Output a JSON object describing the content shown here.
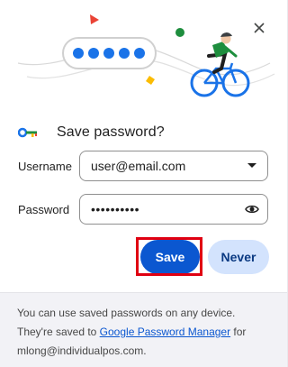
{
  "dialog": {
    "title": "Save password?",
    "close_icon": "close-icon",
    "key_icon": "key-icon"
  },
  "fields": {
    "username": {
      "label": "Username",
      "value": "user@email.com",
      "trailing_icon": "chevron-down-icon"
    },
    "password": {
      "label": "Password",
      "value": "••••••••••",
      "trailing_icon": "eye-icon"
    }
  },
  "buttons": {
    "save": "Save",
    "never": "Never"
  },
  "footer": {
    "text_before": "You can use saved passwords on any device. They're saved to ",
    "link": "Google Password Manager",
    "text_after": " for mlong@individualpos.com."
  },
  "colors": {
    "primary": "#0b57d0",
    "secondary_bg": "#d3e3fd",
    "highlight": "#e00012"
  }
}
